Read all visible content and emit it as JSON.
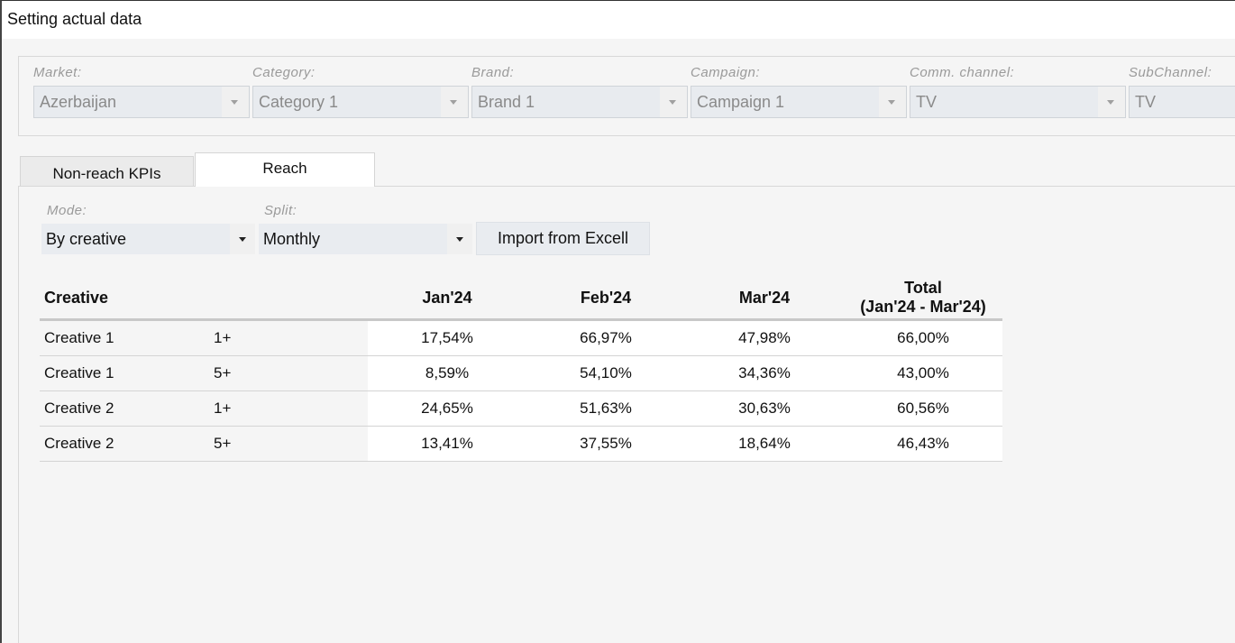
{
  "window": {
    "title": "Setting actual data"
  },
  "filters": [
    {
      "label": "Market:",
      "value": "Azerbaijan"
    },
    {
      "label": "Category:",
      "value": "Category 1"
    },
    {
      "label": "Brand:",
      "value": "Brand 1"
    },
    {
      "label": "Campaign:",
      "value": "Campaign 1"
    },
    {
      "label": "Comm. channel:",
      "value": "TV"
    },
    {
      "label": "SubChannel:",
      "value": "TV"
    }
  ],
  "tabs": [
    {
      "label": "Non-reach KPIs",
      "active": false
    },
    {
      "label": "Reach",
      "active": true
    }
  ],
  "controls": {
    "mode_label": "Mode:",
    "mode_value": "By creative",
    "split_label": "Split:",
    "split_value": "Monthly",
    "import_button": "Import from Excell"
  },
  "table": {
    "headers": {
      "creative": "Creative",
      "jan": "Jan'24",
      "feb": "Feb'24",
      "mar": "Mar'24",
      "total_line1": "Total",
      "total_line2": "(Jan'24 - Mar'24)"
    },
    "rows": [
      {
        "creative": "Creative 1",
        "freq": "1+",
        "jan": "17,54%",
        "feb": "66,97%",
        "mar": "47,98%",
        "total": "66,00%"
      },
      {
        "creative": "Creative 1",
        "freq": "5+",
        "jan": "8,59%",
        "feb": "54,10%",
        "mar": "34,36%",
        "total": "43,00%"
      },
      {
        "creative": "Creative 2",
        "freq": "1+",
        "jan": "24,65%",
        "feb": "51,63%",
        "mar": "30,63%",
        "total": "60,56%"
      },
      {
        "creative": "Creative 2",
        "freq": "5+",
        "jan": "13,41%",
        "feb": "37,55%",
        "mar": "18,64%",
        "total": "46,43%"
      }
    ]
  }
}
